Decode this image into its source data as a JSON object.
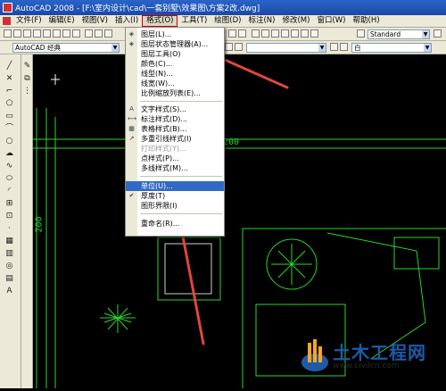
{
  "window": {
    "title": "AutoCAD 2008 - [F:\\室内设计\\cad\\一套别墅\\效果图\\方案2改.dwg]"
  },
  "menubar": [
    {
      "label": "文件(F)"
    },
    {
      "label": "编辑(E)"
    },
    {
      "label": "视图(V)"
    },
    {
      "label": "插入(I)"
    },
    {
      "label": "格式(O)"
    },
    {
      "label": "工具(T)"
    },
    {
      "label": "绘图(D)"
    },
    {
      "label": "标注(N)"
    },
    {
      "label": "修改(M)"
    },
    {
      "label": "窗口(W)"
    },
    {
      "label": "帮助(H)"
    }
  ],
  "toolbar": {
    "workspace": "AutoCAD 经典",
    "text_style": "Standard",
    "color": "白"
  },
  "format_menu": {
    "items": [
      {
        "label": "图层(L)...",
        "icon": "layer-icon"
      },
      {
        "label": "图层状态管理器(A)...",
        "icon": "layer-state-icon"
      },
      {
        "label": "图层工具(O)",
        "icon": ""
      },
      {
        "label": "颜色(C)...",
        "icon": ""
      },
      {
        "label": "线型(N)...",
        "icon": ""
      },
      {
        "label": "线宽(W)...",
        "icon": ""
      },
      {
        "label": "比例缩放列表(E)...",
        "icon": ""
      },
      {
        "label": "文字样式(S)...",
        "icon": "text-style-icon"
      },
      {
        "label": "标注样式(D)...",
        "icon": "dim-style-icon"
      },
      {
        "label": "表格样式(B)...",
        "icon": "table-style-icon"
      },
      {
        "label": "多重引线样式(I)",
        "icon": "mleader-style-icon"
      },
      {
        "label": "打印样式(Y)...",
        "icon": ""
      },
      {
        "label": "点样式(P)...",
        "icon": ""
      },
      {
        "label": "多线样式(M)...",
        "icon": ""
      },
      {
        "label": "单位(U)...",
        "icon": ""
      },
      {
        "label": "厚度(T)",
        "icon": "thickness-icon"
      },
      {
        "label": "图形界限(I)",
        "icon": ""
      },
      {
        "label": "重命名(R)...",
        "icon": ""
      }
    ]
  },
  "drawing": {
    "dim_top": "200",
    "dim_left": "200"
  },
  "watermark": {
    "title": "土木工程网",
    "url": "www.civilcn.com"
  },
  "colors": {
    "line": "#2bd62b",
    "highlight": "#316ac5",
    "arrow": "#e0463c"
  }
}
